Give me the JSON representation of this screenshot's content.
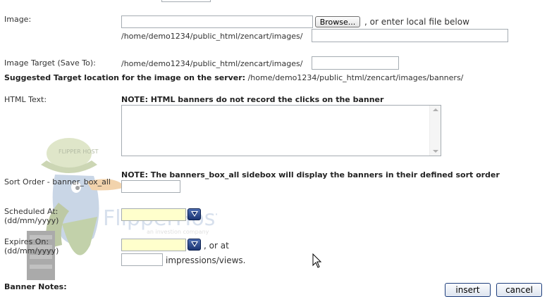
{
  "image": {
    "label": "Image:",
    "browse_button": "Browse...",
    "or_local_text": ", or enter local file below",
    "local_path": "/home/demo1234/public_html/zencart/images/"
  },
  "image_target": {
    "label": "Image Target (Save To):",
    "path": "/home/demo1234/public_html/zencart/images/"
  },
  "suggested": {
    "label": "Suggested Target location for the image on the server:",
    "path": "/home/demo1234/public_html/zencart/images/banners/"
  },
  "html_text": {
    "label": "HTML Text:",
    "note": "NOTE: HTML banners do not record the clicks on the banner"
  },
  "sort_order": {
    "note": "NOTE: The banners_box_all sidebox will display the banners in their defined sort order",
    "label": "Sort Order - banner_box_all"
  },
  "scheduled": {
    "label": "Scheduled At:",
    "format": "(dd/mm/yyyy)"
  },
  "expires": {
    "label": "Expires On:",
    "format": "(dd/mm/yyyy)",
    "or_at": ", or at",
    "impressions": "impressions/views."
  },
  "banner_notes": {
    "label": "Banner Notes:"
  },
  "buttons": {
    "insert": "insert",
    "cancel": "cancel"
  },
  "watermark": {
    "logo_text": "FlipperHost",
    "tagline": "an investion company",
    "cap_text": "FLIPPER HOST"
  },
  "colors": {
    "date_field_bg": "#ffffcc",
    "calendar_button": "#1b3473",
    "button_border": "#1e3e7c"
  }
}
